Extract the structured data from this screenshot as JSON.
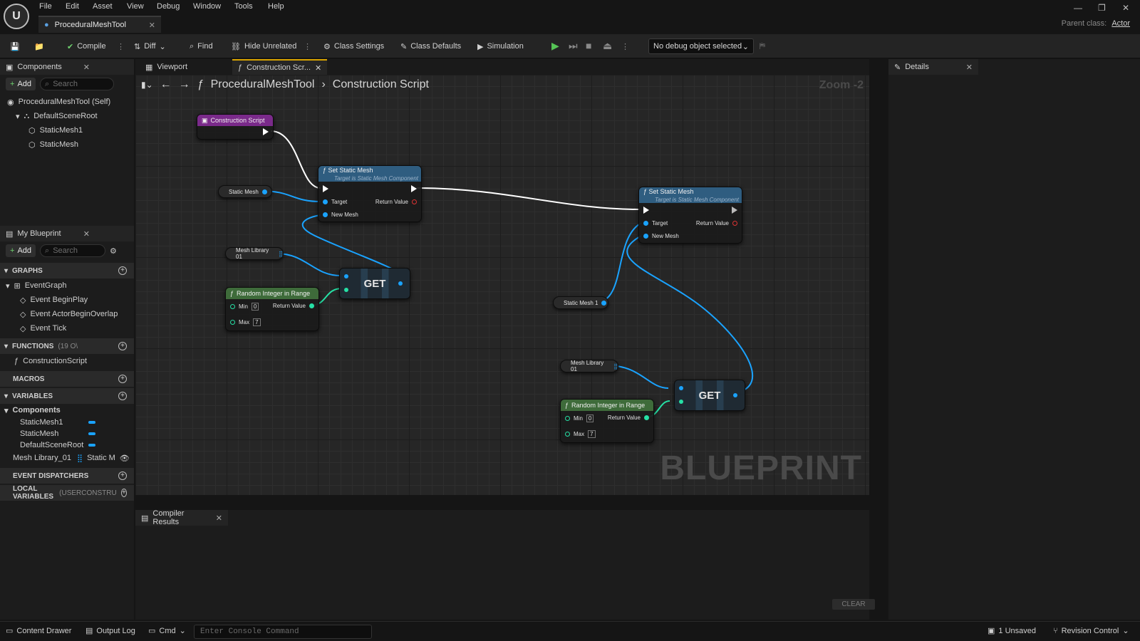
{
  "menu": [
    "File",
    "Edit",
    "Asset",
    "View",
    "Debug",
    "Window",
    "Tools",
    "Help"
  ],
  "document_tab": "ProceduralMeshTool",
  "parent_class": {
    "label": "Parent class:",
    "value": "Actor"
  },
  "toolbar": {
    "compile": "Compile",
    "diff": "Diff",
    "find": "Find",
    "hide_unrelated": "Hide Unrelated",
    "class_settings": "Class Settings",
    "class_defaults": "Class Defaults",
    "simulation": "Simulation",
    "debug_select": "No debug object selected"
  },
  "components_panel": {
    "title": "Components",
    "add": "Add",
    "search_placeholder": "Search",
    "tree": [
      "ProceduralMeshTool (Self)",
      "DefaultSceneRoot",
      "StaticMesh1",
      "StaticMesh"
    ]
  },
  "my_blueprint": {
    "title": "My Blueprint",
    "add": "Add",
    "search_placeholder": "Search",
    "graphs_label": "GRAPHS",
    "event_graph": "EventGraph",
    "events": [
      "Event BeginPlay",
      "Event ActorBeginOverlap",
      "Event Tick"
    ],
    "functions_label": "FUNCTIONS",
    "functions_count": "(19 O\\",
    "functions": [
      "ConstructionScript"
    ],
    "macros_label": "MACROS",
    "variables_label": "VARIABLES",
    "components_label": "Components",
    "component_vars": [
      "StaticMesh1",
      "StaticMesh",
      "DefaultSceneRoot"
    ],
    "mesh_library_var": "Mesh Library_01",
    "mesh_library_type": "Static M",
    "event_dispatchers_label": "EVENT DISPATCHERS",
    "local_variables_label": "LOCAL VARIABLES",
    "local_variables_suffix": "(USERCONSTRU"
  },
  "graph_tabs": {
    "viewport": "Viewport",
    "construction": "Construction Scr..."
  },
  "graph": {
    "breadcrumb_root": "ProceduralMeshTool",
    "breadcrumb_leaf": "Construction Script",
    "zoom": "Zoom -2",
    "watermark": "BLUEPRINT",
    "construction_node": "Construction Script",
    "set_static_mesh": "Set Static Mesh",
    "set_static_mesh_sub": "Target is Static Mesh Component",
    "target": "Target",
    "return_value": "Return Value",
    "new_mesh": "New Mesh",
    "static_mesh_var": "Static Mesh",
    "static_mesh1_var": "Static Mesh 1",
    "mesh_library_var": "Mesh Library 01",
    "get": "GET",
    "random_int": "Random Integer in Range",
    "min": "Min",
    "max": "Max",
    "min_value": "0",
    "max_value": "7"
  },
  "compiler": {
    "title": "Compiler Results",
    "clear": "CLEAR"
  },
  "details": {
    "title": "Details"
  },
  "statusbar": {
    "content_drawer": "Content Drawer",
    "output_log": "Output Log",
    "cmd": "Cmd",
    "console_placeholder": "Enter Console Command",
    "unsaved": "1 Unsaved",
    "revision_control": "Revision Control"
  }
}
